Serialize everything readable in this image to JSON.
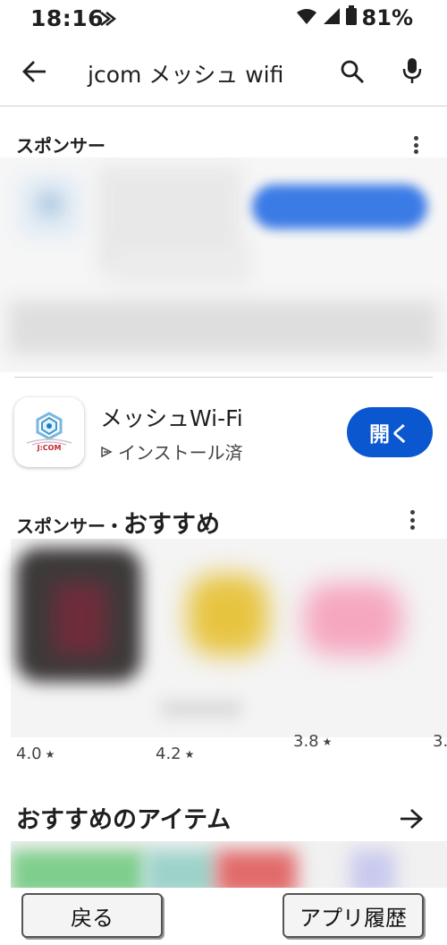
{
  "status_bar": {
    "time": "18:16",
    "battery": "81%"
  },
  "search": {
    "query": "jcom メッシュ wifi"
  },
  "sponsored_section": {
    "label": "スポンサー"
  },
  "installed_app": {
    "name": "メッシュWi-Fi",
    "status": "インストール済",
    "icon_text": "J:COM",
    "open_label": "開く"
  },
  "recommended_section": {
    "sponsor_prefix": "スポンサー・",
    "title": "おすすめ",
    "ratings": [
      "4.0",
      "4.2",
      "3.8",
      "3."
    ]
  },
  "items_section": {
    "title": "おすすめのアイテム"
  },
  "bottom_nav": {
    "back_label": "戻る",
    "history_label": "アプリ履歴"
  },
  "colors": {
    "accent": "#0b57d0",
    "blur_button": "#3b7be6"
  }
}
